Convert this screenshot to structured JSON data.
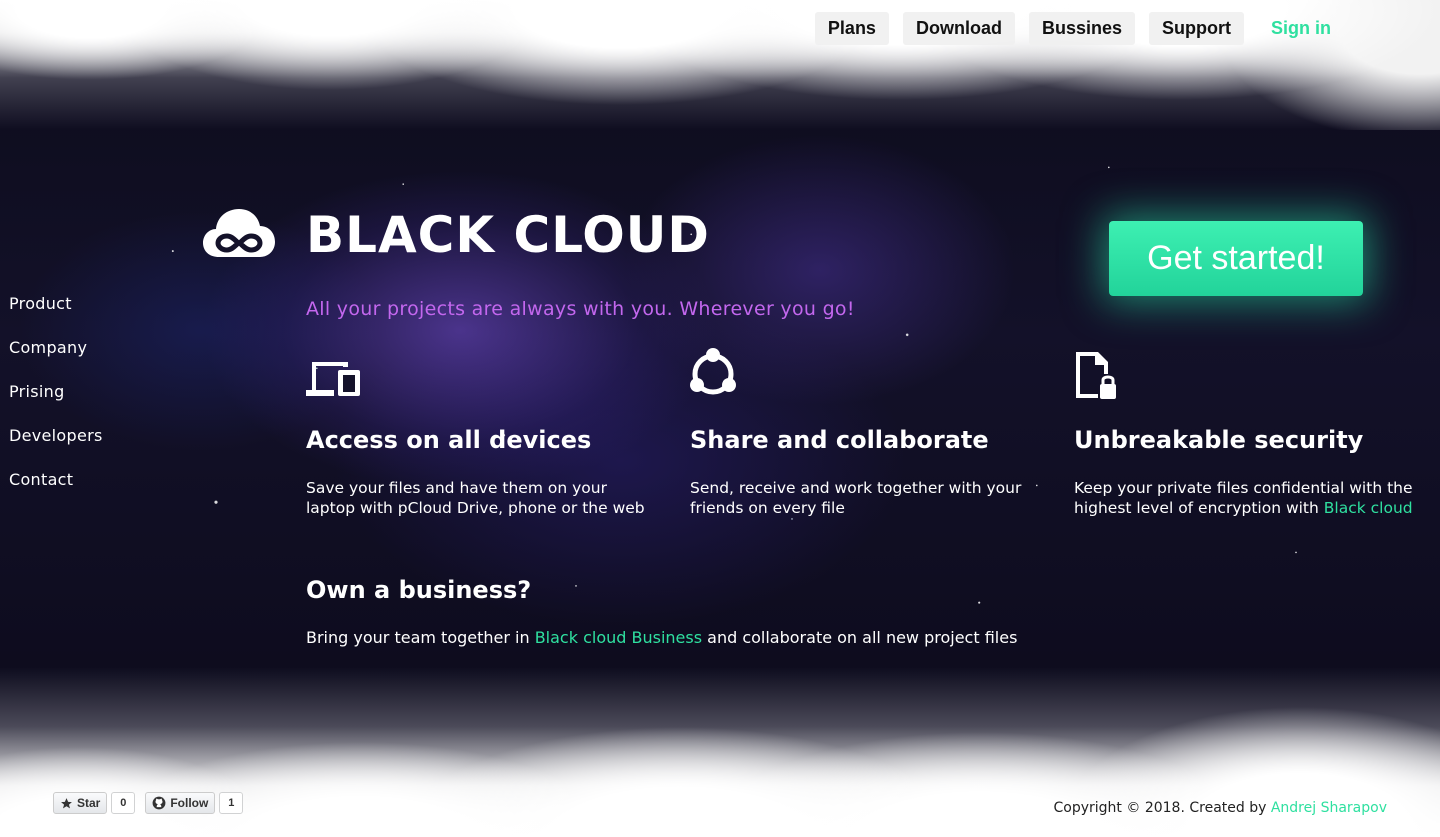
{
  "nav": {
    "items": [
      "Plans",
      "Download",
      "Bussines",
      "Support"
    ],
    "sign_in": "Sign in"
  },
  "sidebar": {
    "items": [
      "Product",
      "Company",
      "Prising",
      "Developers",
      "Contact"
    ]
  },
  "hero": {
    "brand": "BLACK CLOUD",
    "tagline": "All your projects are always with you. Wherever you go!",
    "cta": "Get started!"
  },
  "features": [
    {
      "icon": "devices-icon",
      "title": "Access on all devices",
      "text": "Save your files and have them on your laptop with pCloud Drive, phone or the web"
    },
    {
      "icon": "share-icon",
      "title": "Share and collaborate",
      "text": "Send, receive and work together with your friends on every file"
    },
    {
      "icon": "file-lock-icon",
      "title": "Unbreakable security",
      "text": "Keep your private files confidential with the highest level of encryption with",
      "link": "Black cloud"
    }
  ],
  "business": {
    "title": "Own a business?",
    "text_before": "Bring your team together in",
    "link": "Black cloud Business",
    "text_after": "and collaborate on all new project files"
  },
  "footer": {
    "github": {
      "star_label": "Star",
      "star_count": "0",
      "follow_label": "Follow",
      "follow_count": "1"
    },
    "copyright": "Copyright © 2018. Created by",
    "author": "Andrej Sharapov"
  },
  "colors": {
    "accent": "#2fe0a0",
    "tagline": "#c367ee",
    "background": "#0e0c1c"
  }
}
